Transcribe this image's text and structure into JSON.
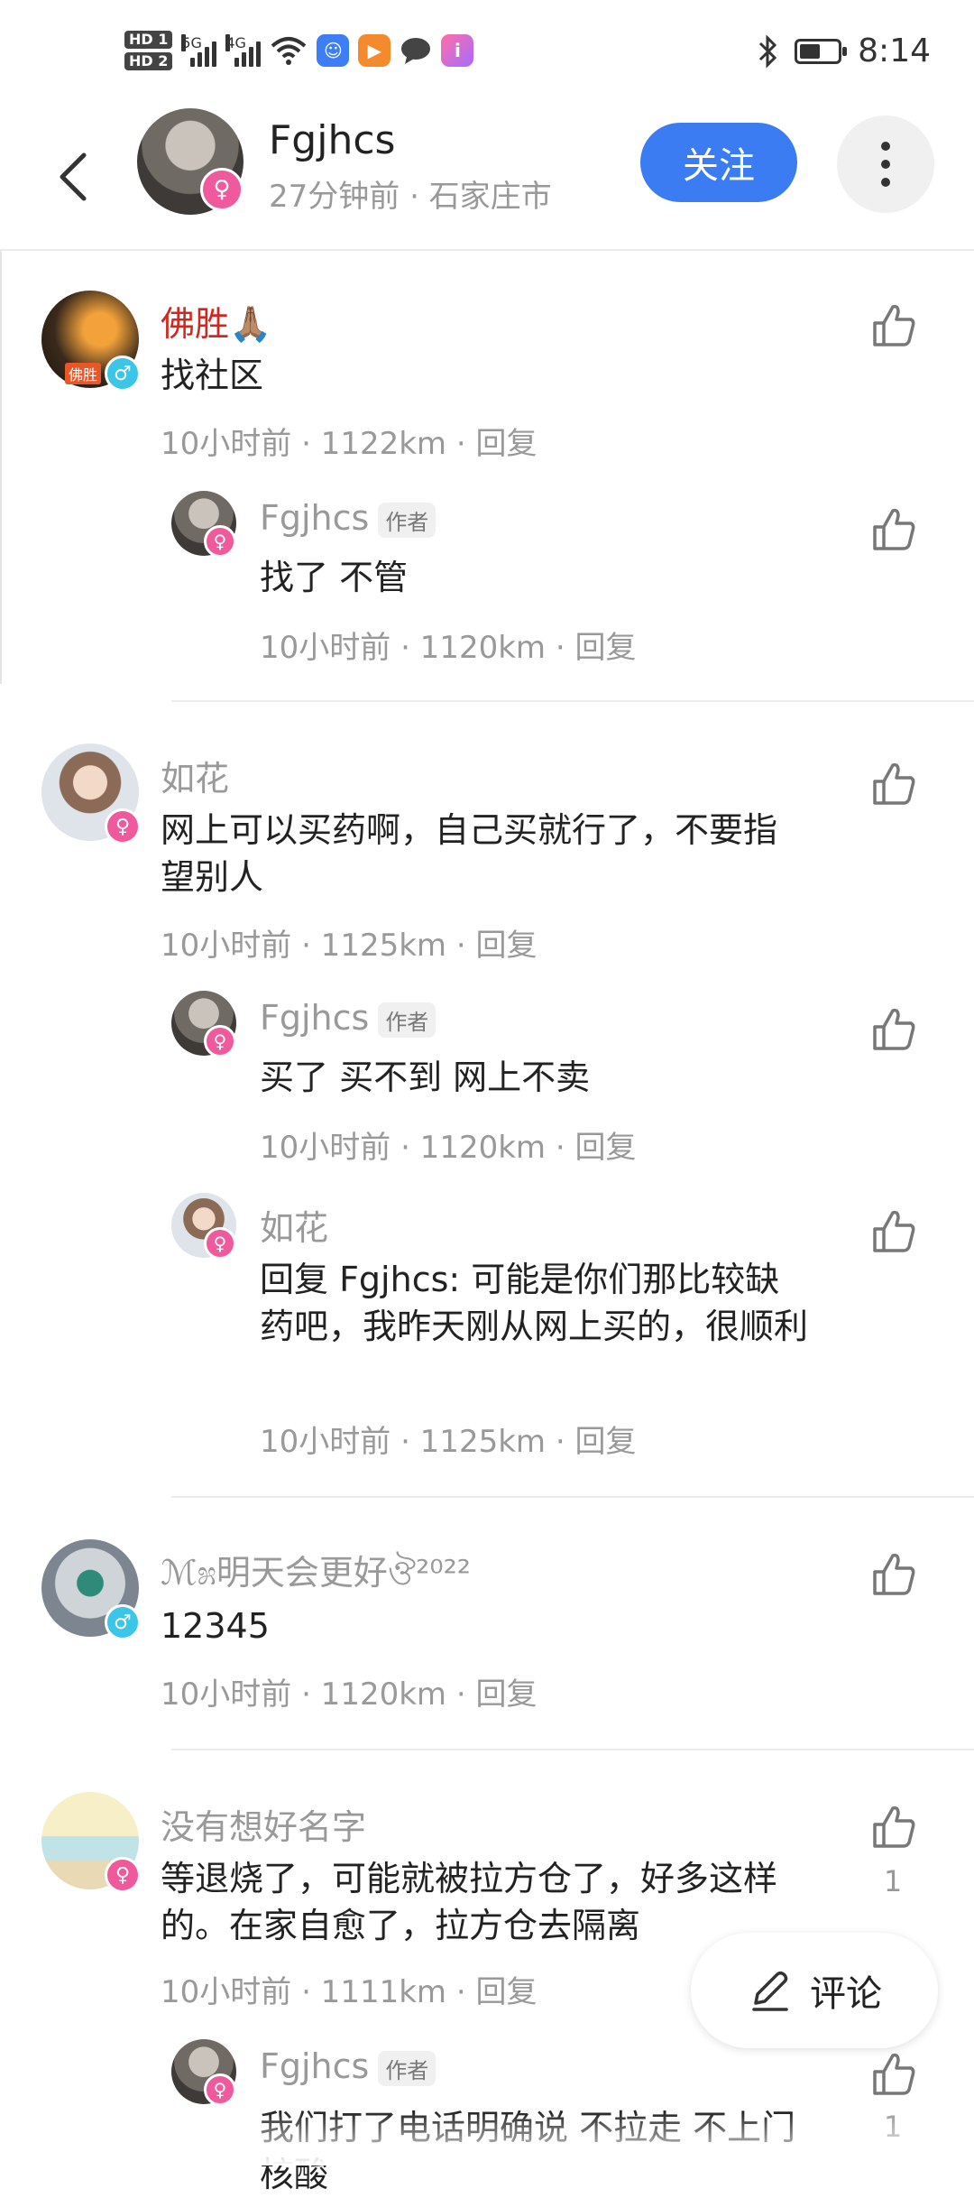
{
  "status_bar": {
    "hd1": "HD 1",
    "hd2": "HD 2",
    "sig1_label": "5G",
    "sig2_label": "4G",
    "time": "8:14",
    "battery_level": 0.55,
    "icons": [
      "hd-sim-icon",
      "signal-icon",
      "wifi-icon",
      "app-notification-icon",
      "video-app-icon",
      "chat-bubble-icon",
      "app-icon",
      "bluetooth-icon",
      "battery-icon"
    ]
  },
  "header": {
    "name": "Fgjhcs",
    "meta": "27分钟前 · 石家庄市",
    "follow_label": "关注"
  },
  "comments": {
    "c1": {
      "name": "佛胜🙏🏽",
      "text": "找社区",
      "meta": "10小时前 · 1122km · 回复",
      "avatar_label": "佛胜"
    },
    "r1": {
      "name": "Fgjhcs",
      "tag": "作者",
      "text": "找了 不管",
      "meta": "10小时前 · 1120km · 回复"
    },
    "c2": {
      "name": "如花",
      "text": "网上可以买药啊，自己买就行了，不要指望别人",
      "meta": "10小时前 · 1125km · 回复"
    },
    "r2": {
      "name": "Fgjhcs",
      "tag": "作者",
      "text": "买了 买不到 网上不卖",
      "meta": "10小时前 · 1120km · 回复"
    },
    "r3": {
      "name": "如花",
      "text": "回复 Fgjhcs: 可能是你们那比较缺药吧，我昨天刚从网上买的，很顺利",
      "meta": "10小时前 · 1125km · 回复"
    },
    "c3": {
      "name": "ℳ೫明天会更好ঔ²⁰²²",
      "text": "12345",
      "meta": "10小时前 · 1120km · 回复"
    },
    "c4": {
      "name": "没有想好名字",
      "text": "等退烧了，可能就被拉方仓了，好多这样的。在家自愈了，拉方仓去隔离",
      "meta": "10小时前 · 1111km · 回复",
      "likes": "1"
    },
    "r4": {
      "name": "Fgjhcs",
      "tag": "作者",
      "text": "我们打了电话明确说 不拉走 不上门核酸",
      "likes": "1"
    }
  },
  "fab": {
    "label": "评论"
  }
}
